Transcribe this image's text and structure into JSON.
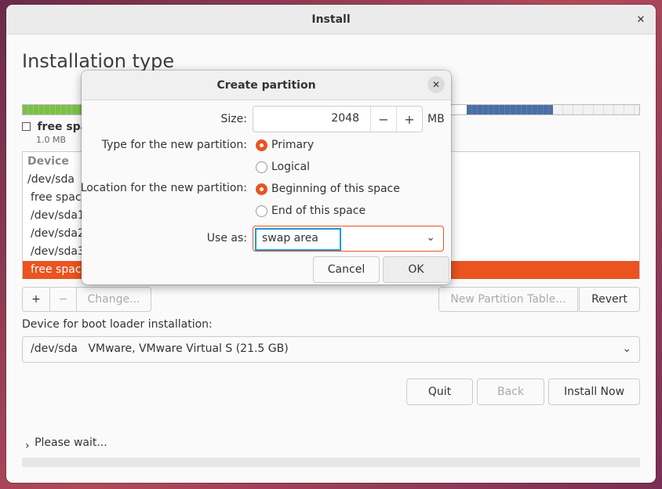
{
  "window": {
    "title": "Install",
    "heading": "Installation type"
  },
  "partition_bar": {
    "legend_label": "free spa",
    "legend_size": "1.0 MB",
    "colors": {
      "used": "#7cc04a",
      "other": "#4a6fa5",
      "free": "#ffffff"
    }
  },
  "table": {
    "header": "Device",
    "rows": [
      {
        "label": "/dev/sda"
      },
      {
        "label": "free space"
      },
      {
        "label": "/dev/sda1"
      },
      {
        "label": "/dev/sda2"
      },
      {
        "label": "/dev/sda3"
      },
      {
        "label": "free space"
      }
    ],
    "selected_color": "#e95420"
  },
  "table_buttons": {
    "add": "+",
    "remove": "−",
    "change": "Change...",
    "new_table": "New Partition Table...",
    "revert": "Revert"
  },
  "boot": {
    "label": "Device for boot loader installation:",
    "value": "/dev/sda   VMware, VMware Virtual S (21.5 GB)"
  },
  "actions": {
    "quit": "Quit",
    "back": "Back",
    "install": "Install Now"
  },
  "status": {
    "text": "Please wait..."
  },
  "dialog": {
    "title": "Create partition",
    "size_label": "Size:",
    "size_value": "2048",
    "size_unit": "MB",
    "minus": "−",
    "plus": "+",
    "type_label": "Type for the new partition:",
    "type_options": [
      "Primary",
      "Logical"
    ],
    "type_selected": "Primary",
    "location_label": "Location for the new partition:",
    "location_options": [
      "Beginning of this space",
      "End of this space"
    ],
    "location_selected": "Beginning of this space",
    "use_label": "Use as:",
    "use_value": "swap area",
    "cancel": "Cancel",
    "ok": "OK",
    "accent": "#e95420",
    "focus": "#1a9ae0"
  }
}
